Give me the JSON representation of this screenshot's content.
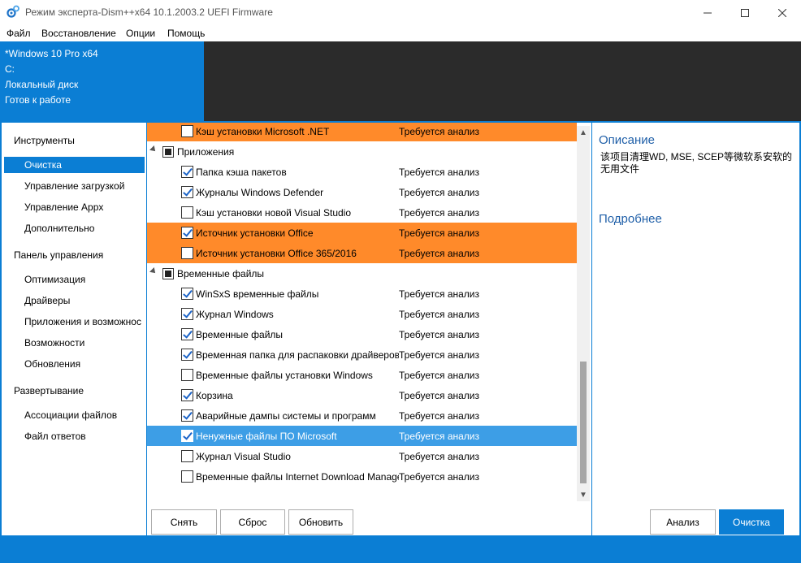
{
  "window": {
    "title": "Режим эксперта-Dism++x64 10.1.2003.2 UEFI Firmware",
    "minimize_icon": "minimize-icon",
    "maximize_icon": "maximize-icon",
    "close_icon": "close-icon"
  },
  "menu": [
    "Файл",
    "Восстановление",
    "Опции",
    "Помощь"
  ],
  "info": {
    "os": "*Windows 10 Pro x64",
    "drive": "C:",
    "disk": "Локальный диск",
    "status": "Готов к работе"
  },
  "nav": {
    "tools_head": "Инструменты",
    "tools": [
      "Очистка",
      "Управление загрузкой",
      "Управление Appx",
      "Дополнительно"
    ],
    "control_head": "Панель управления",
    "control": [
      "Оптимизация",
      "Драйверы",
      "Приложения и возможнос",
      "Возможности",
      "Обновления"
    ],
    "deploy_head": "Развертывание",
    "deploy": [
      "Ассоциации файлов",
      "Файл ответов"
    ]
  },
  "list": {
    "rows": [
      {
        "type": "item",
        "label": "Кэш установки Microsoft .NET",
        "status": "Требуется анализ",
        "checked": false,
        "highlight": "orange"
      },
      {
        "type": "group",
        "label": "Приложения"
      },
      {
        "type": "item",
        "label": "Папка кэша пакетов",
        "status": "Требуется анализ",
        "checked": true,
        "highlight": ""
      },
      {
        "type": "item",
        "label": "Журналы Windows Defender",
        "status": "Требуется анализ",
        "checked": true,
        "highlight": ""
      },
      {
        "type": "item",
        "label": "Кэш установки новой Visual Studio",
        "status": "Требуется анализ",
        "checked": false,
        "highlight": ""
      },
      {
        "type": "item",
        "label": "Источник установки Office",
        "status": "Требуется анализ",
        "checked": true,
        "highlight": "orange"
      },
      {
        "type": "item",
        "label": "Источник установки Office 365/2016",
        "status": "Требуется анализ",
        "checked": false,
        "highlight": "orange"
      },
      {
        "type": "group",
        "label": "Временные файлы"
      },
      {
        "type": "item",
        "label": "WinSxS временные файлы",
        "status": "Требуется анализ",
        "checked": true,
        "highlight": ""
      },
      {
        "type": "item",
        "label": "Журнал Windows",
        "status": "Требуется анализ",
        "checked": true,
        "highlight": ""
      },
      {
        "type": "item",
        "label": "Временные файлы",
        "status": "Требуется анализ",
        "checked": true,
        "highlight": ""
      },
      {
        "type": "item",
        "label": "Временная папка для распаковки драйверов",
        "status": "Требуется анализ",
        "checked": true,
        "highlight": ""
      },
      {
        "type": "item",
        "label": "Временные файлы установки Windows",
        "status": "Требуется анализ",
        "checked": false,
        "highlight": ""
      },
      {
        "type": "item",
        "label": "Корзина",
        "status": "Требуется анализ",
        "checked": true,
        "highlight": ""
      },
      {
        "type": "item",
        "label": "Аварийные дампы системы и программ",
        "status": "Требуется анализ",
        "checked": true,
        "highlight": ""
      },
      {
        "type": "item",
        "label": "Ненужные файлы ПО Microsoft",
        "status": "Требуется анализ",
        "checked": true,
        "highlight": "blue"
      },
      {
        "type": "item",
        "label": "Журнал Visual Studio",
        "status": "Требуется анализ",
        "checked": false,
        "highlight": ""
      },
      {
        "type": "item",
        "label": "Временные файлы Internet Download Manager",
        "status": "Требуется анализ",
        "checked": false,
        "highlight": ""
      }
    ]
  },
  "buttons": {
    "remove": "Снять",
    "reset": "Сброс",
    "refresh": "Обновить",
    "analyze": "Анализ",
    "clean": "Очистка"
  },
  "right": {
    "desc_head": "Описание",
    "desc_text": "该项目清理WD, MSE, SCEP等微软系安软的无用文件",
    "more_head": "Подробнее"
  },
  "colors": {
    "accent": "#0b7ed4",
    "orange_highlight": "#ff8a2a",
    "blue_highlight": "#3d9ee6"
  }
}
